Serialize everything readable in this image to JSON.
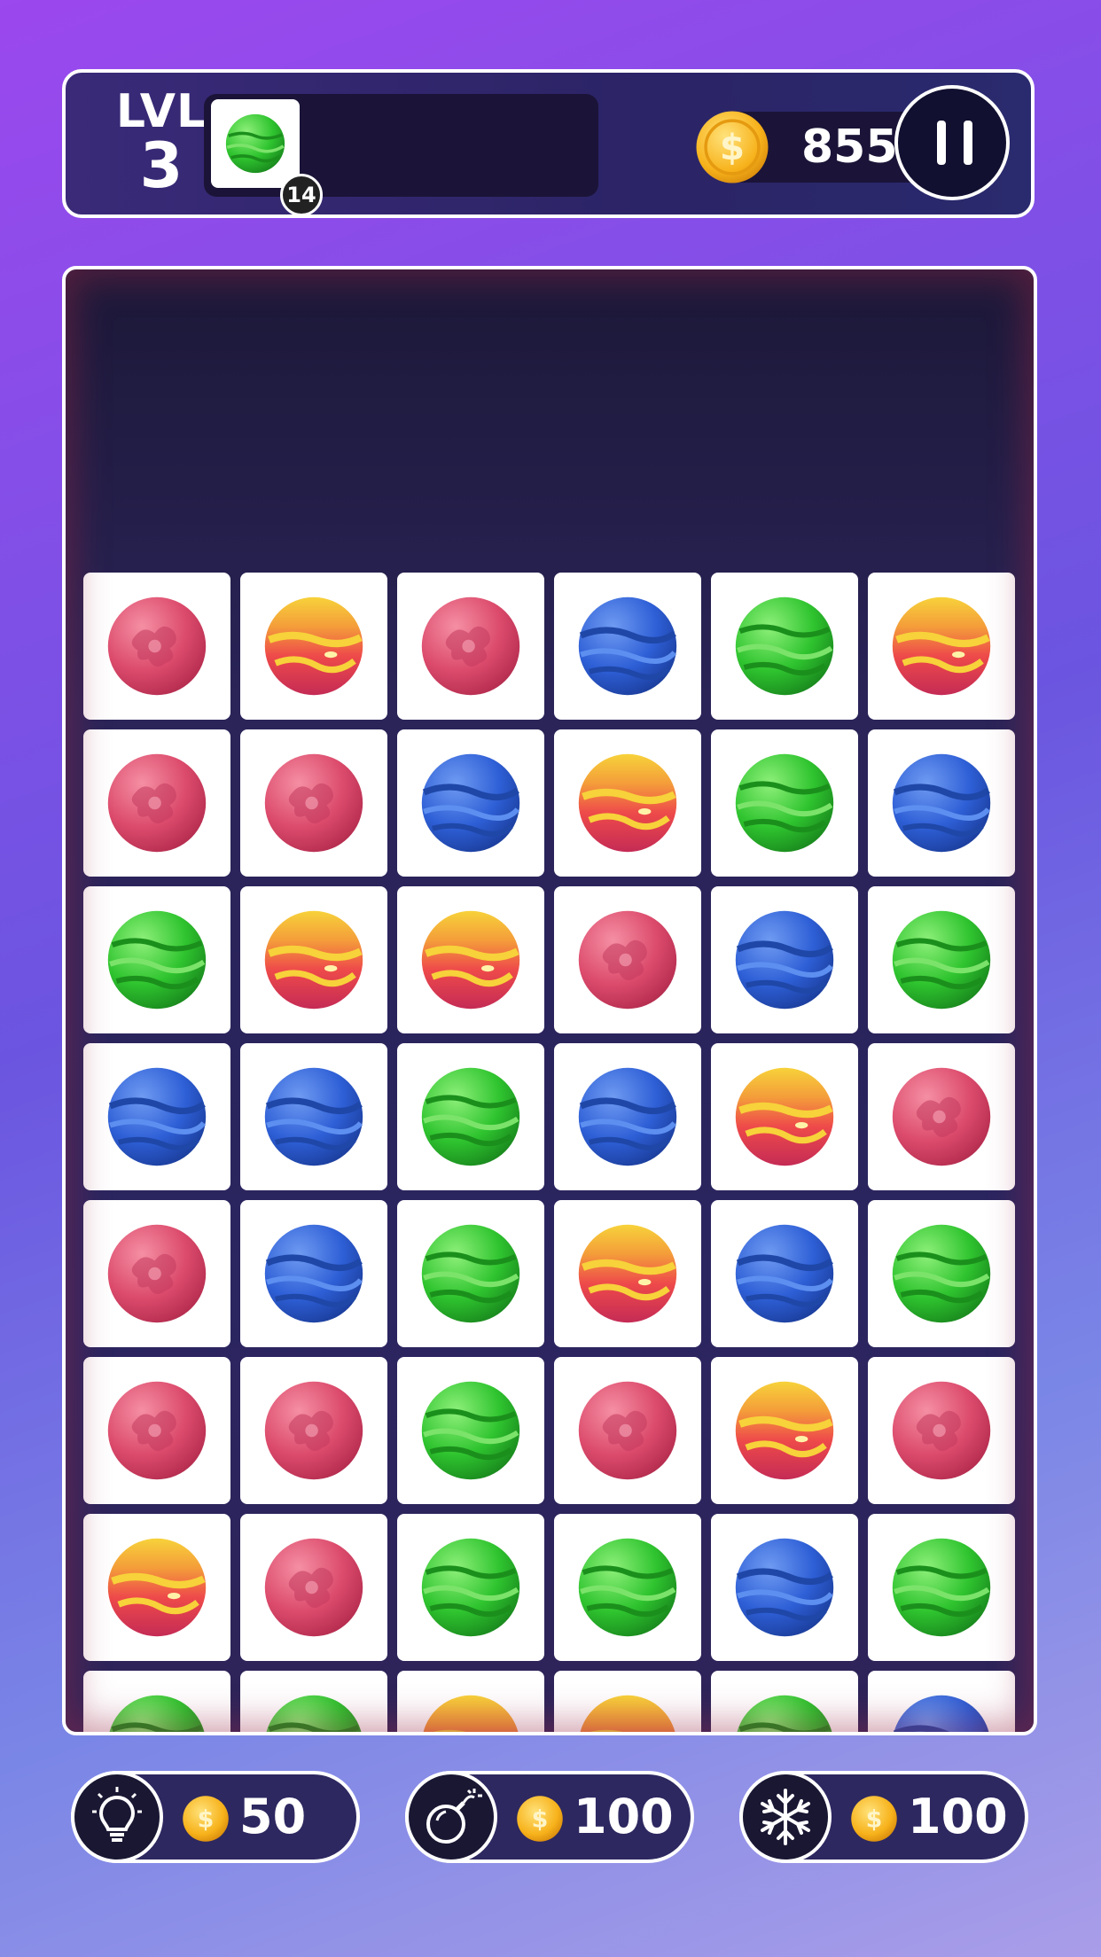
{
  "header": {
    "level_label": "LVL",
    "level_number": "3",
    "goal": {
      "planet": "green",
      "count": "14"
    },
    "coins": "855"
  },
  "board": {
    "rows": [
      [
        "red",
        "orange",
        "red",
        "blue",
        "green",
        "orange"
      ],
      [
        "red",
        "red",
        "blue",
        "orange",
        "green",
        "blue"
      ],
      [
        "green",
        "orange",
        "orange",
        "red",
        "blue",
        "green"
      ],
      [
        "blue",
        "blue",
        "green",
        "blue",
        "orange",
        "red"
      ],
      [
        "red",
        "blue",
        "green",
        "orange",
        "blue",
        "green"
      ],
      [
        "red",
        "red",
        "green",
        "red",
        "orange",
        "red"
      ],
      [
        "orange",
        "red",
        "green",
        "green",
        "blue",
        "green"
      ],
      [
        "green",
        "green",
        "orange",
        "orange",
        "green",
        "blue"
      ]
    ]
  },
  "boosters": [
    {
      "name": "hint",
      "icon": "lightbulb-icon",
      "price": "50"
    },
    {
      "name": "bomb",
      "icon": "bomb-icon",
      "price": "100"
    },
    {
      "name": "freeze",
      "icon": "snowflake-icon",
      "price": "100"
    }
  ],
  "colors": {
    "red": "#d8466a",
    "orange": "#ee4a4a",
    "blue": "#2e5fd6",
    "green": "#2fc42f",
    "coin": "#f7b21b"
  }
}
